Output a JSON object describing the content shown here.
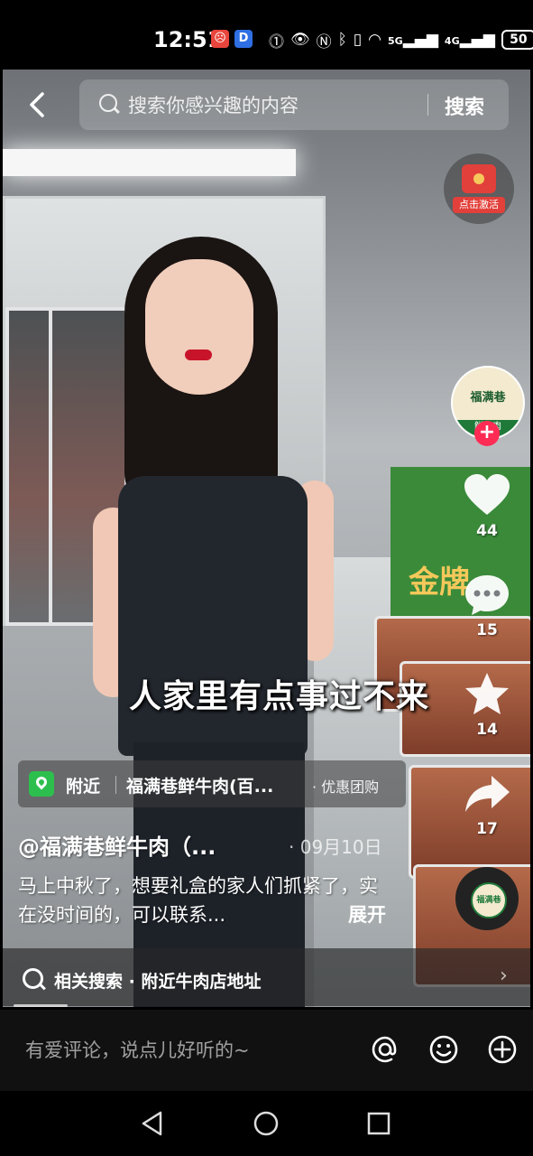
{
  "status_bar": {
    "time": "12:51",
    "network_5g": "5G",
    "network_4g": "4G",
    "battery": "50"
  },
  "topbar": {
    "search_placeholder": "搜索你感兴趣的内容",
    "search_button": "搜索"
  },
  "video": {
    "subtitle": "人家里有点事过不来",
    "gift_box_text": "金牌"
  },
  "redpacket": {
    "label": "点击激活"
  },
  "creator": {
    "avatar_text": "福满巷",
    "avatar_sub": "鲜牛肉"
  },
  "actions": {
    "likes": "44",
    "comments": "15",
    "favorites": "14",
    "shares": "17"
  },
  "music": {
    "disc_text": "福满巷"
  },
  "poi": {
    "nearby": "附近",
    "name": "福满巷鲜牛肉(百...",
    "tag": "· 优惠团购"
  },
  "post": {
    "author": "@福满巷鲜牛肉（...",
    "date": "· 09月10日",
    "caption": "马上中秋了，想要礼盒的家人们抓紧了，实在没时间的，可以联系...",
    "expand": "展开"
  },
  "related": {
    "text": "相关搜索 · 附近牛肉店地址"
  },
  "comment_bar": {
    "placeholder": "有爱评论，说点儿好听的~"
  },
  "colors": {
    "like_red": "#fe2c55",
    "poi_green": "#2dbf4e"
  }
}
